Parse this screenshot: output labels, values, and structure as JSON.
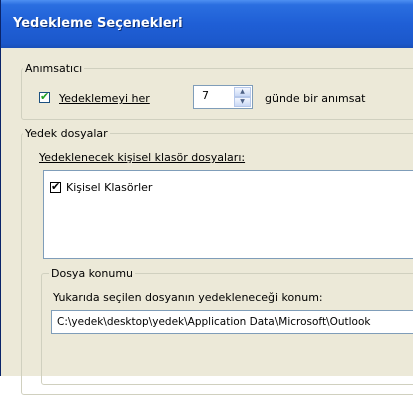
{
  "window": {
    "title": "Yedekleme Seçenekleri"
  },
  "reminder": {
    "group_label": "Anımsatıcı",
    "checkbox_label": "Yedeklemeyi her",
    "checked": true,
    "days_value": "7",
    "suffix_label": "günde bir anımsat"
  },
  "backup_files": {
    "group_label": "Yedek dosyalar",
    "list_label": "Yedeklenecek kişisel klasör dosyaları:",
    "items": [
      {
        "label": "Kişisel Klasörler",
        "checked": true
      }
    ]
  },
  "location": {
    "group_label": "Dosya konumu",
    "path_label": "Yukarıda seçilen dosyanın yedekleneceği konum:",
    "path_value": "C:\\yedek\\desktop\\yedek\\Application Data\\Microsoft\\Outlook"
  }
}
